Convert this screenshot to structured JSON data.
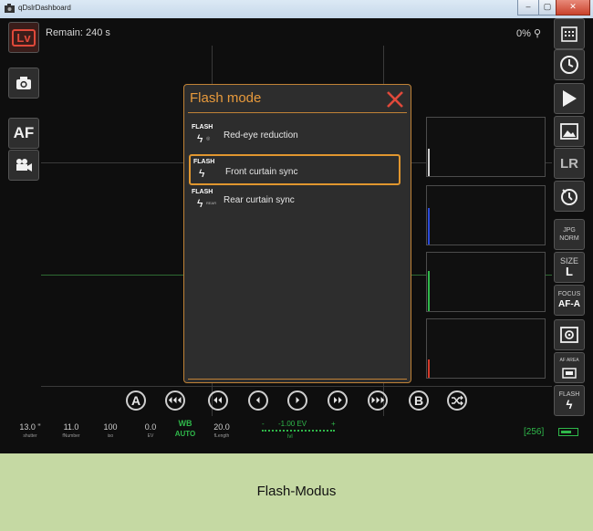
{
  "window": {
    "title": "qDslrDashboard",
    "min_glyph": "‒",
    "max_glyph": "▢",
    "close_glyph": "✕"
  },
  "liveview": {
    "remain": "Remain:  240 s",
    "zoom": "0% ",
    "lv_label": "Lv",
    "af_label": "AF"
  },
  "dialog": {
    "title": "Flash mode",
    "items": [
      {
        "tag": "FLASH",
        "glyph": "ϟ",
        "sub": "◎",
        "label": "Red-eye reduction",
        "selected": false
      },
      {
        "tag": "FLASH",
        "glyph": "ϟ",
        "sub": "",
        "label": "Front curtain sync",
        "selected": true
      },
      {
        "tag": "FLASH",
        "glyph": "ϟ",
        "sub": "REAR",
        "label": "Rear curtain sync",
        "selected": false
      }
    ]
  },
  "right_panel": {
    "lr_label": "LR",
    "jpg_top": "JPG",
    "jpg_bottom": "NORM",
    "size_top": "SIZE",
    "size_bottom": "L",
    "focus_top": "FOCUS",
    "focus_bottom": "AF-A",
    "afarea_top": "AF AREA",
    "flash_top": "FLASH"
  },
  "nav": {
    "a": "A",
    "b": "B"
  },
  "stats": {
    "shutter": {
      "value": "13.0 \"",
      "label": "shutter"
    },
    "fnumber": {
      "value": "11.0",
      "label": "fNumber"
    },
    "iso": {
      "value": "100",
      "label": "iso"
    },
    "ev": {
      "value": "0.0",
      "label": "EV"
    },
    "wb": {
      "value": "WB",
      "label": "AUTO"
    },
    "flength": {
      "value": "20.0",
      "label": "fLength"
    }
  },
  "exposure": {
    "value": "-1.00 EV",
    "minus": "-",
    "plus": "+",
    "label": "lvl"
  },
  "shots": "[256]",
  "caption": "Flash-Modus",
  "colors": {
    "accent": "#e89a3c",
    "green": "#2fb84a",
    "lv_red": "#c0392b"
  }
}
